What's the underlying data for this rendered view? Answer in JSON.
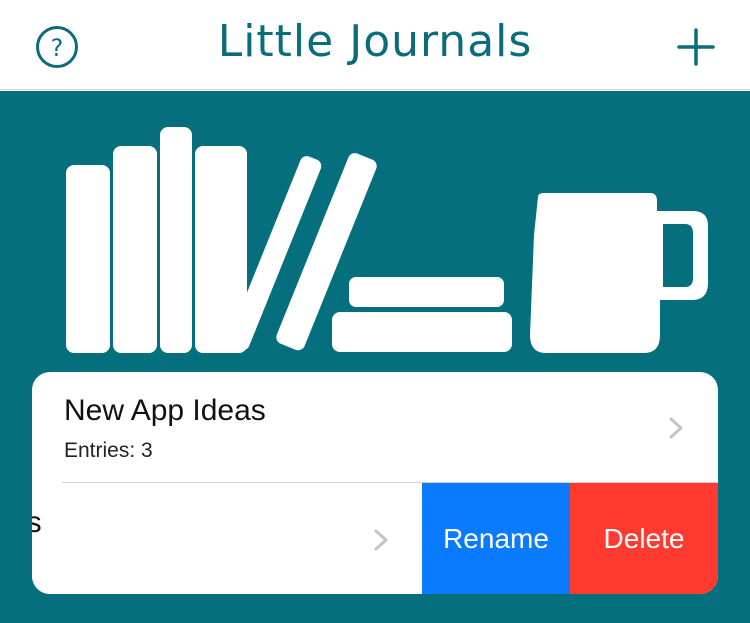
{
  "navbar": {
    "title": "Little Journals",
    "help_icon": "question-circle-icon",
    "add_icon": "plus-icon"
  },
  "colors": {
    "brand": "#066f7e",
    "rename": "#0a7aff",
    "delete": "#ff3b30"
  },
  "illustration": {
    "name": "bookshelf-with-mug"
  },
  "journals": [
    {
      "title": "New App Ideas",
      "entries_text": "Entries: 3"
    },
    {
      "title_visible": "es"
    }
  ],
  "swipe_actions": {
    "rename_label": "Rename",
    "delete_label": "Delete"
  }
}
